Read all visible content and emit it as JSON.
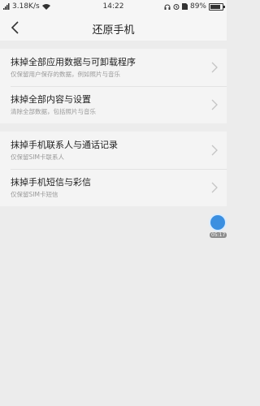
{
  "status_bar": {
    "speed": "3.18K/s",
    "time": "14:22",
    "battery": "89%",
    "battery_level": 0.89
  },
  "header": {
    "title": "还原手机"
  },
  "groups": [
    {
      "items": [
        {
          "title": "抹掉全部应用数据与可卸载程序",
          "subtitle": "仅保留用户保存的数据，例如照片与音乐"
        },
        {
          "title": "抹掉全部内容与设置",
          "subtitle": "清除全部数据，包括照片与音乐"
        }
      ]
    },
    {
      "items": [
        {
          "title": "抹掉手机联系人与通话记录",
          "subtitle": "仅保留SIM卡联系人"
        },
        {
          "title": "抹掉手机短信与彩信",
          "subtitle": "仅保留SIM卡短信"
        }
      ]
    }
  ],
  "floating_widget": {
    "time": "05:17"
  }
}
